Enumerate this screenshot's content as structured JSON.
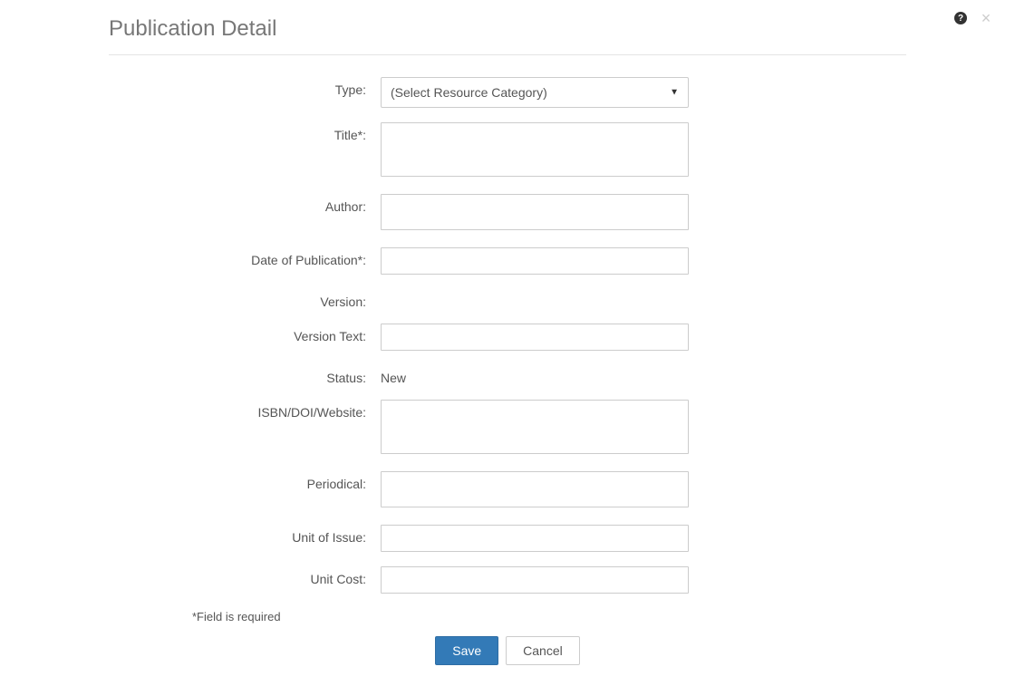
{
  "header": {
    "title": "Publication Detail"
  },
  "form": {
    "type_label": "Type:",
    "type_selected": "(Select Resource Category)",
    "title_label": "Title*:",
    "title_value": "",
    "author_label": "Author:",
    "author_value": "",
    "date_label": "Date of Publication*:",
    "date_value": "",
    "version_label": "Version:",
    "version_text_label": "Version Text:",
    "version_text_value": "",
    "status_label": "Status:",
    "status_value": "New",
    "isbn_label": "ISBN/DOI/Website:",
    "isbn_value": "",
    "periodical_label": "Periodical:",
    "periodical_value": "",
    "unit_issue_label": "Unit of Issue:",
    "unit_issue_value": "",
    "unit_cost_label": "Unit Cost:",
    "unit_cost_value": ""
  },
  "footer": {
    "required_note": "*Field is required",
    "save_label": "Save",
    "cancel_label": "Cancel"
  }
}
